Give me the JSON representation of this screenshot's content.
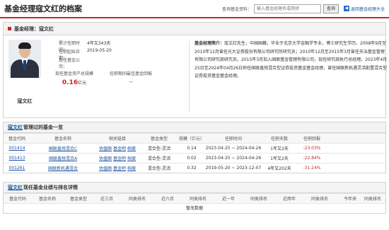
{
  "header": {
    "title": "基金经理寇文红的档案",
    "search_label": "查询基金资料：",
    "search_placeholder": "输入基金经理名或简拼",
    "search_button": "查询",
    "back_icon": "arrow-left-icon",
    "back_label": "返回基金经理大全"
  },
  "manager": {
    "section_label": "基金经理：寇文红",
    "name": "寇文红",
    "info": [
      {
        "k": "累计任职时间：",
        "v": "4年又343天"
      },
      {
        "k": "任职起始日期：",
        "v": "2019-05-20"
      },
      {
        "k": "现任基金公司：",
        "v": ""
      }
    ],
    "stat1_label": "现任基金资产总规模",
    "stat1_value": "0.16",
    "stat1_unit": "亿元",
    "stat2_label": "任职期间最佳基金回报",
    "stat2_value": "--",
    "intro_title": "基金经理简介：",
    "intro_text": "寇文红先生，中国国籍，毕业于北京大学金融学专业，博士研究生学历。2008年9月至2010年12月曾任光大证券股份有限公司研究所研究员；2010年12月至2015年3月曾任天治基金管理有限公司研究部研究员。2015年3月加入国联基金管理有限公司，现任研究部执行总经理。2023年4月25日至2024年04月26日担任国联鑫悦混合型证券投资基金基金经理，曾任国联新机遇灵活配置混合型证券投资基金基金经理。"
  },
  "funds_section": {
    "name": "寇文红",
    "title_suffix": "管理过的基金一览",
    "headers": [
      "基金代码",
      "基金名称",
      "相关链接",
      "基金类型",
      "规模（亿元）",
      "任职时间",
      "任职天数",
      "任职回报"
    ],
    "rows": [
      {
        "code": "001414",
        "name": "国联鑫悦混合C",
        "links": [
          "估值图",
          "基金吧",
          "档案"
        ],
        "type": "混合型-灵活",
        "scale": "0.14",
        "period": "2023-04-25 ~ 2024-04-26",
        "days": "1年又2天",
        "ret": "-23.03%"
      },
      {
        "code": "001413",
        "name": "国联鑫悦混合A",
        "links": [
          "估值图",
          "基金吧",
          "档案"
        ],
        "type": "混合型-灵活",
        "scale": "0.02",
        "period": "2023-04-25 ~ 2024-04-26",
        "days": "1年又2天",
        "ret": "-22.84%"
      },
      {
        "code": "001261",
        "name": "国联新机遇混合",
        "links": [
          "估值图",
          "基金吧",
          "档案"
        ],
        "type": "混合型-灵活",
        "scale": "0.32",
        "period": "2019-05-20 ~ 2023-12-07",
        "days": "4年又202天",
        "ret": "-31.24%"
      }
    ]
  },
  "perf_section": {
    "name": "寇文红",
    "title_suffix": "现任基金业绩与排名详情",
    "headers": [
      "基金代码",
      "基金名称",
      "基金类型",
      "近三月",
      "同类排名",
      "近六月",
      "同类排名",
      "近一年",
      "同类排名",
      "近两年",
      "同类排名",
      "今年来",
      "同类排名"
    ],
    "empty_text": "暂无数据"
  },
  "colors": {
    "accent": "#c9252b",
    "link": "#1a53a0"
  }
}
